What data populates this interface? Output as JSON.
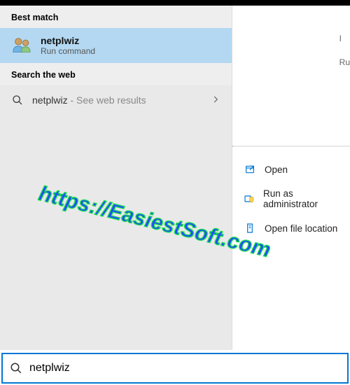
{
  "header": {
    "best_match_label": "Best match",
    "search_web_label": "Search the web"
  },
  "best_match": {
    "title": "netplwiz",
    "subtitle": "Run command"
  },
  "web_result": {
    "query": "netplwiz",
    "suffix": " - See web results"
  },
  "right_edge": {
    "line1": "I",
    "line2": "Ru"
  },
  "actions": {
    "open": "Open",
    "admin": "Run as administrator",
    "location": "Open file location"
  },
  "search": {
    "value": "netplwiz",
    "placeholder": ""
  },
  "watermark": "https://EasiestSoft.com"
}
